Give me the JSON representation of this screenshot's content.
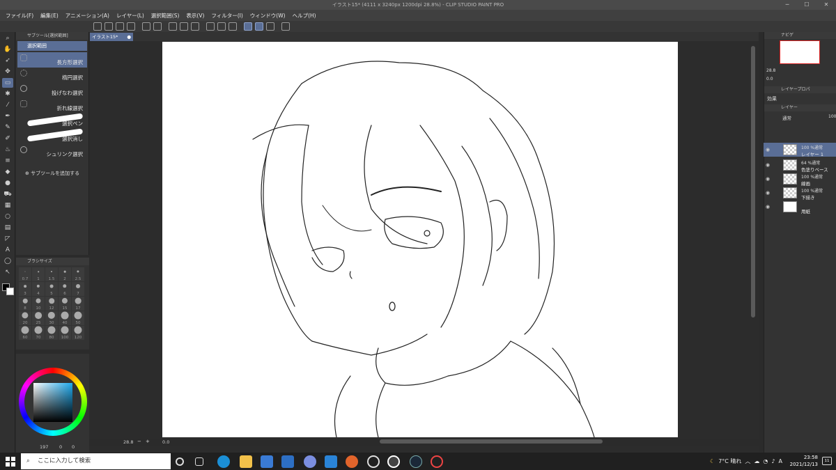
{
  "window": {
    "title": "イラスト15* (4111 x 3240px 1200dpi 28.8%) - CLIP STUDIO PAINT PRO"
  },
  "menu": [
    "ファイル(F)",
    "編集(E)",
    "アニメーション(A)",
    "レイヤー(L)",
    "選択範囲(S)",
    "表示(V)",
    "フィルター(I)",
    "ウィンドウ(W)",
    "ヘルプ(H)"
  ],
  "subtool": {
    "header": "サブツール[選択範囲]",
    "group": "選択範囲",
    "items": [
      "長方形選択",
      "楕円選択",
      "投げなわ選択",
      "折れ線選択",
      "選択ペン",
      "選択消し",
      "シュリンク選択"
    ],
    "add": "サブツールを追加する"
  },
  "brushsize": {
    "header": "ブラシサイズ",
    "sizes": [
      "0.7",
      "1",
      "1.5",
      "2",
      "2.5",
      "3",
      "4",
      "5",
      "6",
      "7",
      "8",
      "10",
      "12",
      "15",
      "17",
      "20",
      "25",
      "30",
      "40",
      "50",
      "60",
      "70",
      "80",
      "100",
      "120"
    ]
  },
  "color": {
    "value1": "197",
    "value2": "0",
    "value3": "0"
  },
  "canvas": {
    "tab": "イラスト15*",
    "zoom": "28.8",
    "angle": "0.0"
  },
  "navigator": {
    "tab": "ナビゲ",
    "zoom": "28.8",
    "angle": "0.0"
  },
  "layerprop": {
    "tab": "レイヤープロパ",
    "effect": "効果"
  },
  "layers": {
    "tab": "レイヤー",
    "mode": "通常",
    "opacity": "100",
    "list": [
      {
        "l1": "100 %通常",
        "l2": "レイヤー 1"
      },
      {
        "l1": "64 %通常",
        "l2": "色塗りベース"
      },
      {
        "l1": "100 %通常",
        "l2": "線画"
      },
      {
        "l1": "100 %通常",
        "l2": "下描き"
      },
      {
        "l1": "",
        "l2": "用紙"
      }
    ]
  },
  "taskbar": {
    "search_placeholder": "ここに入力して検索",
    "weather": "7°C 晴れ",
    "time": "23:58",
    "date": "2021/12/13",
    "ime": "A",
    "notif": "11"
  }
}
